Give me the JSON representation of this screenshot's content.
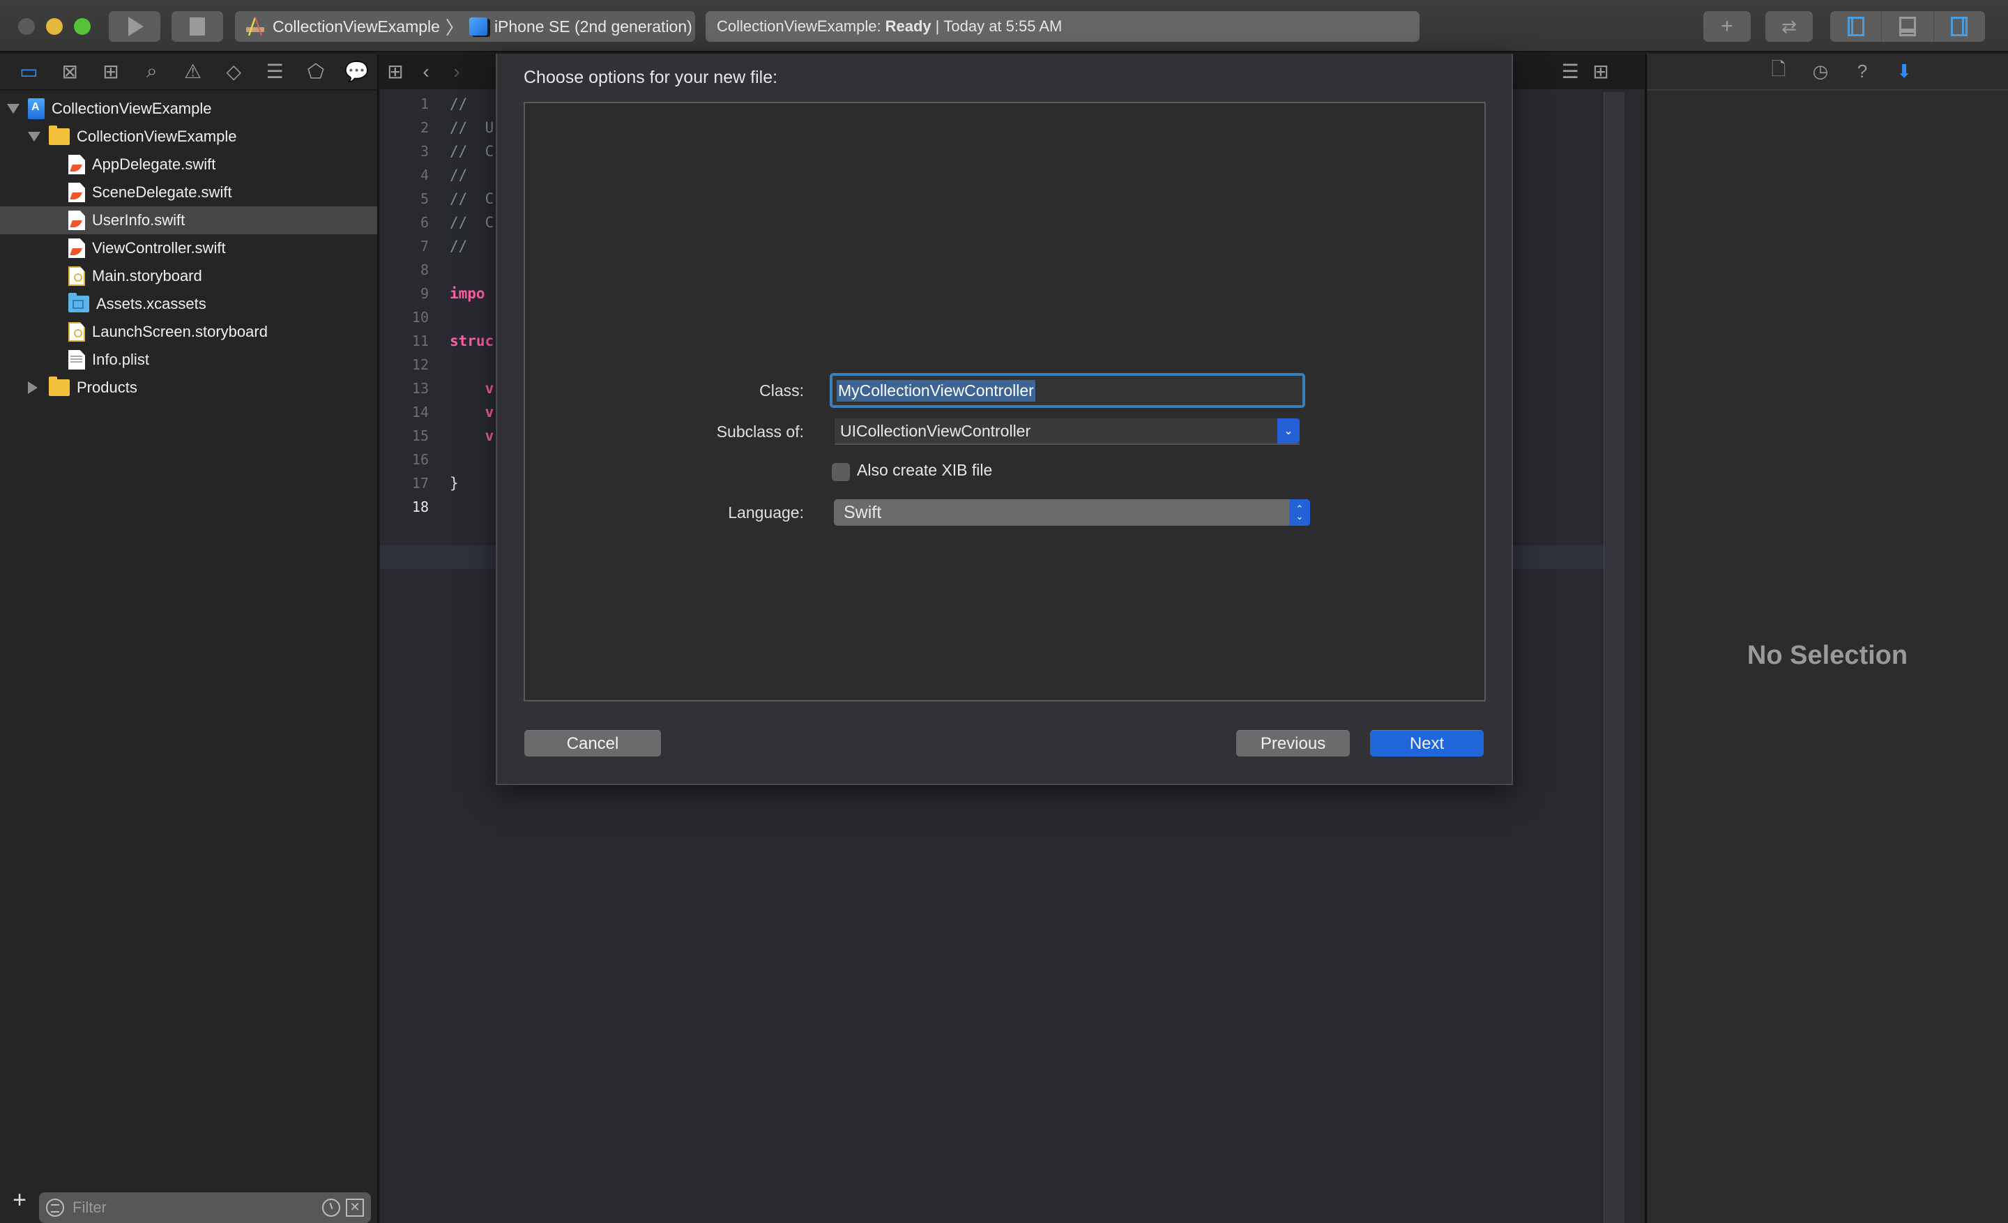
{
  "window": {
    "scheme": {
      "project": "CollectionViewExample",
      "device": "iPhone SE (2nd generation)"
    },
    "activity": {
      "project": "CollectionViewExample:",
      "status": "Ready",
      "separator": "|",
      "timestamp": "Today at 5:55 AM"
    },
    "icons": {
      "run": "play-icon",
      "stop": "stop-icon",
      "library": "plus-icon",
      "review": "swap-arrows-icon"
    }
  },
  "navigator": {
    "tabs": [
      {
        "name": "project-navigator",
        "glyph": "▭",
        "active": true
      },
      {
        "name": "source-control-navigator",
        "glyph": "⊠"
      },
      {
        "name": "symbol-navigator",
        "glyph": "⊞"
      },
      {
        "name": "find-navigator",
        "glyph": "⌕"
      },
      {
        "name": "issue-navigator",
        "glyph": "⚠"
      },
      {
        "name": "test-navigator",
        "glyph": "◇"
      },
      {
        "name": "debug-navigator",
        "glyph": "☰"
      },
      {
        "name": "breakpoint-navigator",
        "glyph": "⬠"
      },
      {
        "name": "report-navigator",
        "glyph": "💬"
      }
    ],
    "tree": [
      {
        "label": "CollectionViewExample",
        "type": "proj",
        "level": 0,
        "disclosure": "open"
      },
      {
        "label": "CollectionViewExample",
        "type": "folder",
        "level": 1,
        "disclosure": "open"
      },
      {
        "label": "AppDelegate.swift",
        "type": "swift",
        "level": 2
      },
      {
        "label": "SceneDelegate.swift",
        "type": "swift",
        "level": 2
      },
      {
        "label": "UserInfo.swift",
        "type": "swift",
        "level": 2,
        "selected": true
      },
      {
        "label": "ViewController.swift",
        "type": "swift",
        "level": 2
      },
      {
        "label": "Main.storyboard",
        "type": "story",
        "level": 2
      },
      {
        "label": "Assets.xcassets",
        "type": "assets",
        "level": 2
      },
      {
        "label": "LaunchScreen.storyboard",
        "type": "story",
        "level": 2
      },
      {
        "label": "Info.plist",
        "type": "plist",
        "level": 2
      },
      {
        "label": "Products",
        "type": "folder",
        "level": 1,
        "disclosure": "closed"
      }
    ],
    "filter": {
      "placeholder": "Filter",
      "value": ""
    }
  },
  "editor": {
    "line_numbers": [
      "1",
      "2",
      "3",
      "4",
      "5",
      "6",
      "7",
      "8",
      "9",
      "10",
      "11",
      "12",
      "13",
      "14",
      "15",
      "16",
      "17",
      "18"
    ],
    "current_line": "18",
    "code_lines": [
      {
        "text": "//",
        "kind": "comment"
      },
      {
        "text": "//  U",
        "kind": "comment"
      },
      {
        "text": "//  C",
        "kind": "comment"
      },
      {
        "text": "//",
        "kind": "comment"
      },
      {
        "text": "//  C",
        "kind": "comment"
      },
      {
        "text": "//  C",
        "kind": "comment"
      },
      {
        "text": "//",
        "kind": "comment"
      },
      {
        "text": "",
        "kind": "plain"
      },
      {
        "text": "impo",
        "kind": "kw"
      },
      {
        "text": "",
        "kind": "plain"
      },
      {
        "text": "struc",
        "kind": "kw"
      },
      {
        "text": "",
        "kind": "plain"
      },
      {
        "text": "    v",
        "kind": "kw"
      },
      {
        "text": "    v",
        "kind": "kw"
      },
      {
        "text": "    v",
        "kind": "kw"
      },
      {
        "text": "",
        "kind": "plain"
      },
      {
        "text": "}",
        "kind": "plain"
      },
      {
        "text": "",
        "kind": "plain"
      }
    ]
  },
  "inspector": {
    "tabs": [
      {
        "name": "file-inspector",
        "glyph": "🗋"
      },
      {
        "name": "history-inspector",
        "glyph": "◷"
      },
      {
        "name": "quick-help-inspector",
        "glyph": "?"
      },
      {
        "name": "attributes-inspector",
        "glyph": "⬇",
        "active": true
      }
    ],
    "empty_text": "No Selection"
  },
  "dialog": {
    "title": "Choose options for your new file:",
    "class_label": "Class:",
    "class_value": "MyCollectionViewController",
    "subclass_label": "Subclass of:",
    "subclass_value": "UICollectionViewController",
    "xib_label": "Also create XIB file",
    "xib_checked": false,
    "language_label": "Language:",
    "language_value": "Swift",
    "cancel": "Cancel",
    "previous": "Previous",
    "next": "Next"
  },
  "colors": {
    "accent": "#2f8dff",
    "primary_button": "#1f66db",
    "focus_ring": "#3a7fb8",
    "selection": "#3c6595",
    "keyword": "#fc5fa3",
    "comment": "#7f8c98"
  }
}
